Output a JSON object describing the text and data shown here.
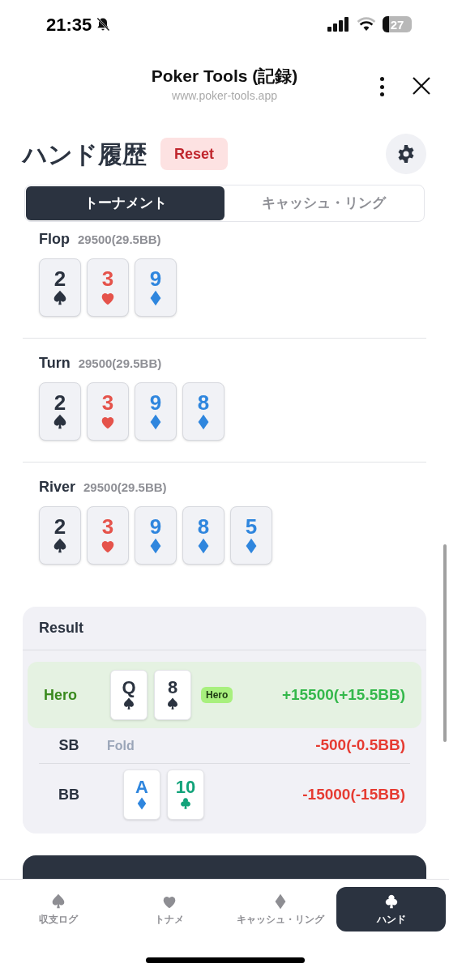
{
  "status_bar": {
    "time": "21:35",
    "battery": "27"
  },
  "header": {
    "title": "Poker Tools (記録)",
    "url": "www.poker-tools.app"
  },
  "page": {
    "title": "ハンド履歴",
    "reset_label": "Reset"
  },
  "tabs": [
    {
      "label": "トーナメント",
      "selected": true
    },
    {
      "label": "キャッシュ・リング",
      "selected": false
    }
  ],
  "streets": [
    {
      "name": "Flop",
      "pot": "29500(29.5BB)",
      "cards": [
        {
          "rank": "2",
          "kind": "spade"
        },
        {
          "rank": "3",
          "kind": "heart"
        },
        {
          "rank": "9",
          "kind": "diamond"
        }
      ]
    },
    {
      "name": "Turn",
      "pot": "29500(29.5BB)",
      "cards": [
        {
          "rank": "2",
          "kind": "spade"
        },
        {
          "rank": "3",
          "kind": "heart"
        },
        {
          "rank": "9",
          "kind": "diamond"
        },
        {
          "rank": "8",
          "kind": "diamond"
        }
      ]
    },
    {
      "name": "River",
      "pot": "29500(29.5BB)",
      "cards": [
        {
          "rank": "2",
          "kind": "spade"
        },
        {
          "rank": "3",
          "kind": "heart"
        },
        {
          "rank": "9",
          "kind": "diamond"
        },
        {
          "rank": "8",
          "kind": "diamond"
        },
        {
          "rank": "5",
          "kind": "diamond"
        }
      ]
    }
  ],
  "result": {
    "title": "Result",
    "rows": [
      {
        "position": "Hero",
        "highlighted": true,
        "cards": [
          {
            "rank": "Q",
            "kind": "spade"
          },
          {
            "rank": "8",
            "kind": "spade"
          }
        ],
        "badge": "Hero",
        "amount": "+15500(+15.5BB)",
        "kind": "win"
      },
      {
        "position": "SB",
        "highlighted": false,
        "action": "Fold",
        "amount": "-500(-0.5BB)",
        "kind": "loss"
      },
      {
        "position": "BB",
        "highlighted": false,
        "cards": [
          {
            "rank": "A",
            "kind": "diamond"
          },
          {
            "rank": "10",
            "kind": "club"
          }
        ],
        "amount": "-15000(-15BB)",
        "kind": "loss"
      }
    ]
  },
  "bottom_nav": [
    {
      "label": "収支ログ",
      "kind": "spade",
      "selected": false
    },
    {
      "label": "トナメ",
      "kind": "heart",
      "selected": false
    },
    {
      "label": "キャッシュ・リング",
      "kind": "diamond",
      "selected": false
    },
    {
      "label": "ハンド",
      "kind": "club",
      "selected": true
    }
  ]
}
